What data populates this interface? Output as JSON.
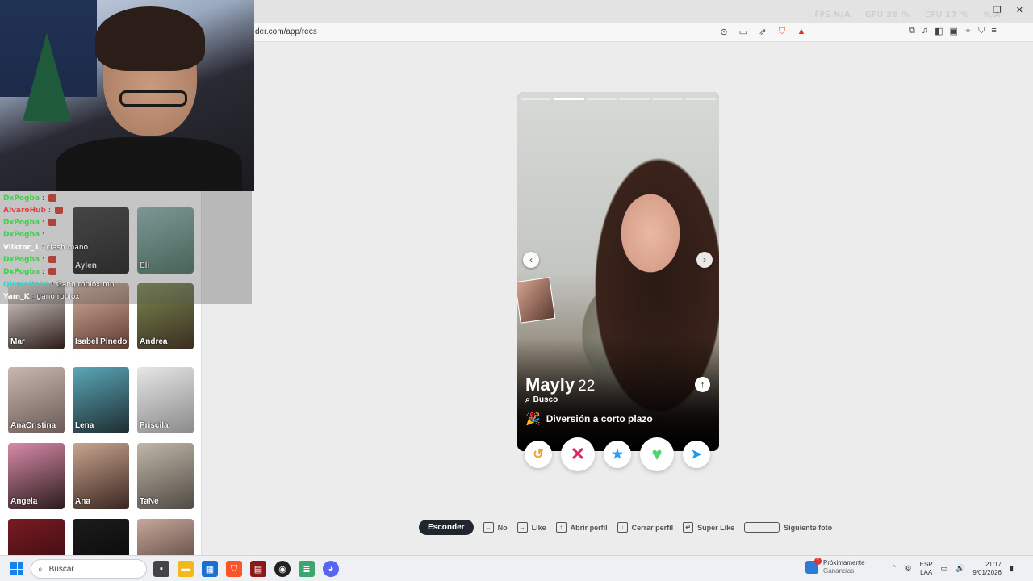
{
  "stats": {
    "fps_label": "FPS",
    "fps_value": "N/A",
    "gpu_label": "GPU",
    "gpu_value": "28 %",
    "cpu_label": "CPU",
    "cpu_value": "17 %",
    "extra_label": "",
    "extra_value": "N/A"
  },
  "browser": {
    "url": "der.com/app/recs"
  },
  "sidebar": {
    "cards": [
      {
        "name": "Aylen"
      },
      {
        "name": "Eli"
      },
      {
        "name": "Mar"
      },
      {
        "name": "Isabel Pinedo"
      },
      {
        "name": "Andrea"
      },
      {
        "name": "AnaCristina"
      },
      {
        "name": "Lena"
      },
      {
        "name": "Priscila"
      },
      {
        "name": "Angela"
      },
      {
        "name": "Ana"
      },
      {
        "name": "TaNe"
      }
    ]
  },
  "chat": {
    "lines": [
      {
        "user": "DxPogba",
        "message": ""
      },
      {
        "user": "AlvaroHub",
        "message": ""
      },
      {
        "user": "DxPogba",
        "message": ""
      },
      {
        "user": "DxPogba",
        "message": ""
      },
      {
        "user": "Viiktor_1",
        "message": "clash mano"
      },
      {
        "user": "DxPogba",
        "message": ""
      },
      {
        "user": "DxPogba",
        "message": ""
      },
      {
        "user": "Qispinlin16",
        "message": "Gano roblox mn"
      },
      {
        "user": "Yam_K",
        "message": "gano roblox"
      }
    ],
    "colors": {
      "DxPogba": "#3bd14a",
      "AlvaroHub": "#e04040",
      "Viiktor_1": "#ffffff",
      "Qispinlin16": "#3bd1c6",
      "Yam_K": "#ffffff"
    }
  },
  "profile": {
    "name": "Mayly",
    "age": "22",
    "looking_label": "Busco",
    "intent": "Diversión a corto plazo",
    "photo_count": 6,
    "active_photo": 1
  },
  "shortcuts": {
    "hide": "Esconder",
    "no": "No",
    "like": "Like",
    "open_profile": "Abrir perfil",
    "close_profile": "Cerrar perfil",
    "super_like": "Super Like",
    "next_photo": "Siguiente foto"
  },
  "taskbar": {
    "search_placeholder": "Buscar",
    "weather_title": "Próximamente",
    "weather_sub": "Ganancias",
    "weather_badge": "1",
    "lang_1": "ESP",
    "lang_2": "LAA",
    "time": "21:17",
    "date": "9/01/2026"
  }
}
